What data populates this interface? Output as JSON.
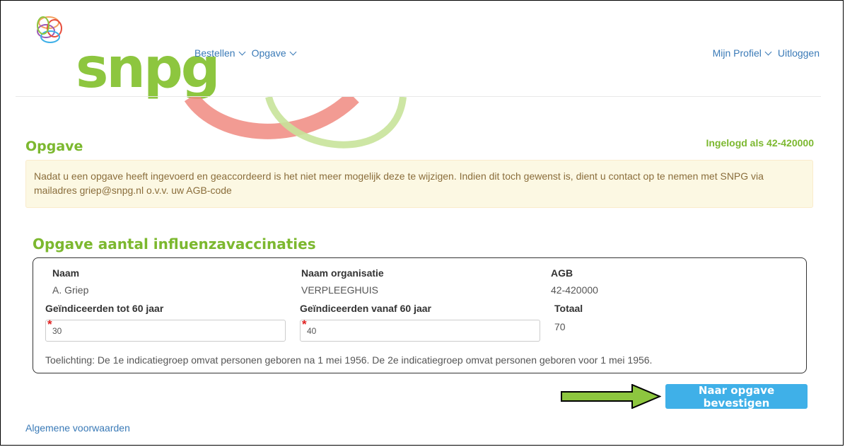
{
  "header": {
    "logo_text": "snpg",
    "nav_left": [
      {
        "label": "Bestellen"
      },
      {
        "label": "Opgave"
      }
    ],
    "nav_right": {
      "profile_label": "Mijn Profiel",
      "logout_label": "Uitloggen"
    }
  },
  "page": {
    "title": "Opgave",
    "logged_in": "Ingelogd als 42-420000",
    "alert": "Nadat u een opgave heeft ingevoerd en geaccordeerd is het niet meer mogelijk deze te wijzigen. Indien dit toch gewenst is, dient u contact op te nemen met SNPG via mailadres griep@snpg.nl o.v.v. uw AGB-code"
  },
  "form": {
    "title": "Opgave aantal influenzavaccinaties",
    "naam_label": "Naam",
    "naam_value": "A. Griep",
    "org_label": "Naam organisatie",
    "org_value": "VERPLEEGHUIS",
    "agb_label": "AGB",
    "agb_value": "42-420000",
    "under60_label": "Geïndiceerden tot 60 jaar",
    "under60_value": "30",
    "over60_label": "Geïndiceerden vanaf 60 jaar",
    "over60_value": "40",
    "total_label": "Totaal",
    "total_value": "70",
    "required_mark": "*",
    "note": "Toelichting: De 1e indicatiegroep omvat personen geboren na 1 mei 1956. De 2e indicatiegroep omvat personen geboren voor 1 mei 1956."
  },
  "actions": {
    "confirm_label": "Naar opgave bevestigen"
  },
  "footer": {
    "terms_link": "Algemene voorwaarden"
  },
  "colors": {
    "brand_green": "#8dc63f",
    "link_blue": "#3a7ab7",
    "button_blue": "#3fb0e8",
    "arrow_green": "#8dc63f"
  }
}
